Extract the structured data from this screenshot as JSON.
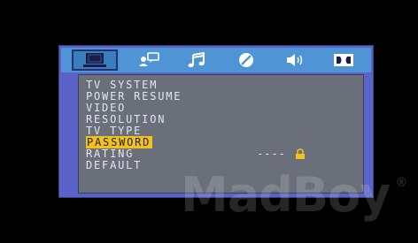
{
  "osd": {
    "colors": {
      "frame": "#5a63c8",
      "tab_bar": "#4f95d6",
      "panel": "#6a6f7a",
      "highlight": "#f2c21a"
    },
    "tabs": [
      {
        "icon": "monitor-icon",
        "active": true
      },
      {
        "icon": "speech-bubble-icon",
        "active": false
      },
      {
        "icon": "music-note-icon",
        "active": false
      },
      {
        "icon": "disc-icon",
        "active": false
      },
      {
        "icon": "speaker-icon",
        "active": false
      },
      {
        "icon": "dolby-icon",
        "active": false
      }
    ],
    "menu": {
      "items": [
        {
          "label": "TV SYSTEM"
        },
        {
          "label": "POWER RESUME"
        },
        {
          "label": "VIDEO"
        },
        {
          "label": "RESOLUTION"
        },
        {
          "label": "TV TYPE"
        },
        {
          "label": "PASSWORD",
          "selected": true
        },
        {
          "label": "RATING"
        },
        {
          "label": "DEFAULT"
        }
      ],
      "selected_value": "----",
      "value_icon": "lock-icon"
    },
    "watermark": {
      "text": "MadBoy",
      "mark": "®"
    }
  }
}
